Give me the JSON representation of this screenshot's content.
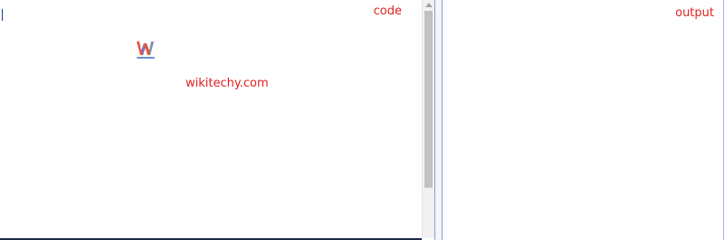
{
  "code_pane": {
    "label": "code",
    "watermark": "wikitechy.com",
    "logo_icon": "wikitechy-logo-icon"
  },
  "output_pane": {
    "label": "output"
  },
  "colors": {
    "label_red": "#e0201e",
    "splitter_blue": "#7aa0e0",
    "scroll_thumb": "#c1c1c1"
  }
}
